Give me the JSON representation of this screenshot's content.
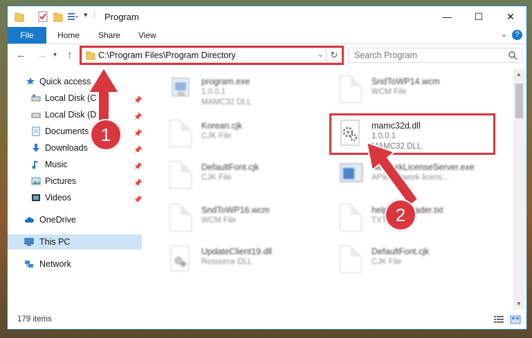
{
  "window": {
    "title": "Program",
    "minimize": "—",
    "maximize": "☐",
    "close": "✕"
  },
  "ribbon": {
    "tabs": [
      {
        "label": "File"
      },
      {
        "label": "Home"
      },
      {
        "label": "Share"
      },
      {
        "label": "View"
      }
    ],
    "help": "?"
  },
  "address": {
    "path": "C:\\Program Files\\Program Directory"
  },
  "search": {
    "placeholder": "Search Program"
  },
  "sidebar": {
    "items": [
      {
        "label": "Quick access",
        "icon": "star-icon"
      },
      {
        "label": "Local Disk (C:)",
        "icon": "drive-icon"
      },
      {
        "label": "Local Disk (D:)",
        "icon": "drive-icon"
      },
      {
        "label": "Documents",
        "icon": "documents-icon"
      },
      {
        "label": "Downloads",
        "icon": "download-icon"
      },
      {
        "label": "Music",
        "icon": "music-icon"
      },
      {
        "label": "Pictures",
        "icon": "pictures-icon"
      },
      {
        "label": "Videos",
        "icon": "videos-icon"
      },
      {
        "label": "OneDrive",
        "icon": "cloud-icon"
      },
      {
        "label": "This PC",
        "icon": "computer-icon"
      },
      {
        "label": "Network",
        "icon": "network-icon"
      }
    ]
  },
  "files": {
    "left": [
      {
        "name": "program.exe",
        "meta1": "1.0.0.1",
        "meta2": "MAMC32 DLL"
      },
      {
        "name": "Korean.cjk",
        "meta1": "CJK File",
        "meta2": ""
      },
      {
        "name": "DefaultFont.cjk",
        "meta1": "CJK File",
        "meta2": ""
      },
      {
        "name": "SndToWP16.wcm",
        "meta1": "WCM File",
        "meta2": ""
      },
      {
        "name": "UpdateClient19.dll",
        "meta1": "Resource DLL",
        "meta2": ""
      }
    ],
    "right": [
      {
        "name": "SndToWP14.wcm",
        "meta1": "WCM File",
        "meta2": ""
      },
      {
        "name": "mamc32d.dll",
        "meta1": "1.0.0.1",
        "meta2": "MAMC32 DLL"
      },
      {
        "name": "NetworkLicenseServer.exe",
        "meta1": "APW network licens...",
        "meta2": ""
      },
      {
        "name": "help.NetReader.txt",
        "meta1": "TXT File",
        "meta2": ""
      },
      {
        "name": "DefaultFont.cjk",
        "meta1": "CJK File",
        "meta2": ""
      }
    ]
  },
  "status": {
    "count": "179 items"
  },
  "annotations": {
    "step1": "1",
    "step2": "2"
  },
  "colors": {
    "accent": "#1979ca",
    "highlight": "#d9363e",
    "selection": "#cce4f7"
  }
}
